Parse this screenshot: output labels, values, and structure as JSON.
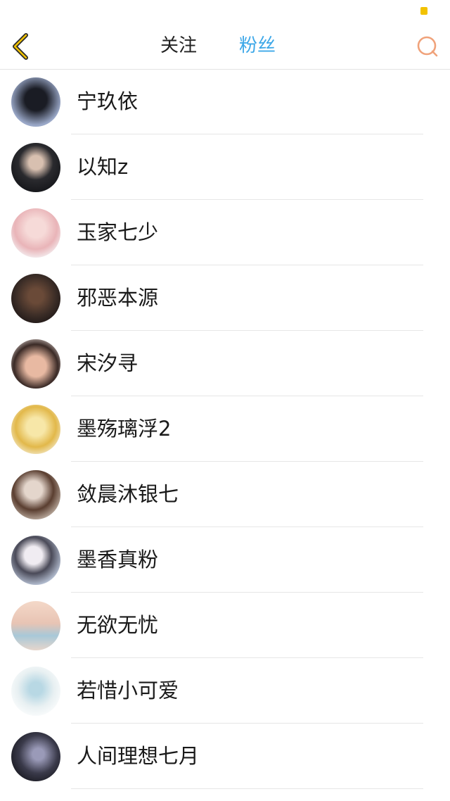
{
  "header": {
    "tabs": [
      {
        "label": "关注",
        "active": false
      },
      {
        "label": "粉丝",
        "active": true
      }
    ],
    "active_color": "#3ea8e8",
    "back_icon": "chevron-left-icon",
    "search_icon": "search-icon"
  },
  "users": [
    {
      "name": "宁玖依"
    },
    {
      "name": "以知z"
    },
    {
      "name": "玉家七少"
    },
    {
      "name": "邪恶本源"
    },
    {
      "name": "宋汐寻"
    },
    {
      "name": "墨殇璃浮2"
    },
    {
      "name": "敛晨沐银七"
    },
    {
      "name": "墨香真粉"
    },
    {
      "name": "无欲无忧"
    },
    {
      "name": "若惜小可爱"
    },
    {
      "name": "人间理想七月"
    }
  ]
}
